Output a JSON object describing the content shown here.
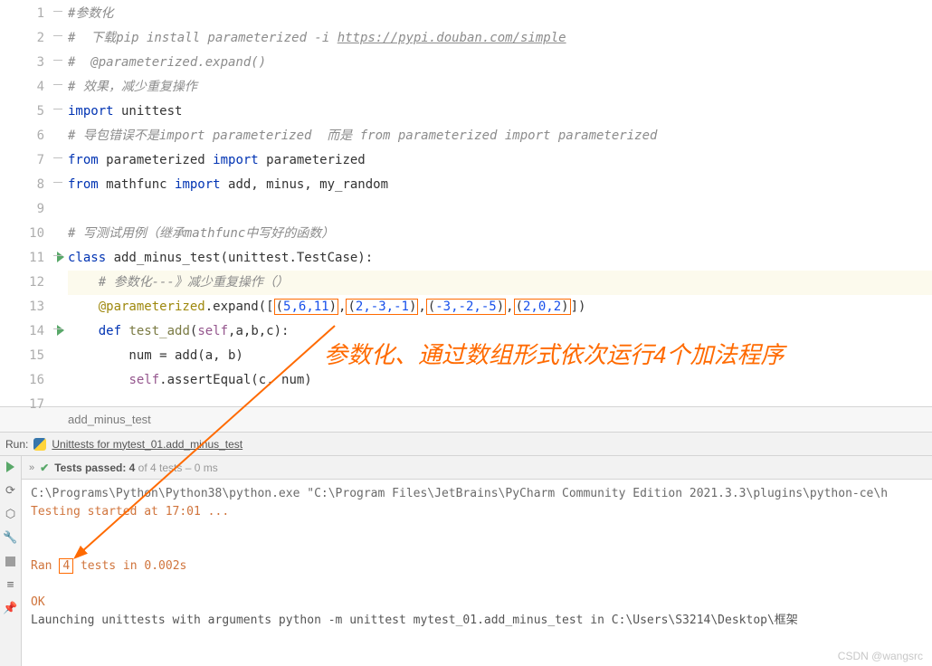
{
  "lines": [
    {
      "n": "1"
    },
    {
      "n": "2"
    },
    {
      "n": "3"
    },
    {
      "n": "4"
    },
    {
      "n": "5"
    },
    {
      "n": "6"
    },
    {
      "n": "7"
    },
    {
      "n": "8"
    },
    {
      "n": "9"
    },
    {
      "n": "10"
    },
    {
      "n": "11",
      "run": true
    },
    {
      "n": "12"
    },
    {
      "n": "13"
    },
    {
      "n": "14",
      "run": true
    },
    {
      "n": "15"
    },
    {
      "n": "16"
    },
    {
      "n": "17"
    }
  ],
  "code": {
    "l1": "#参数化",
    "l2a": "#  下载pip install parameterized -i ",
    "l2b": "https://pypi.douban.com/simple",
    "l3": "#  @parameterized.expand()",
    "l4": "# 效果，减少重复操作",
    "l5_kw1": "import",
    "l5_mod": " unittest",
    "l6": "# 导包错误不是import parameterized  而是 from parameterized import parameterized",
    "l7_k1": "from",
    "l7_m1": " parameterized ",
    "l7_k2": "import",
    "l7_m2": " parameterized",
    "l8_k1": "from",
    "l8_m1": " mathfunc ",
    "l8_k2": "import",
    "l8_m2": " add, minus, my_random",
    "l10": "# 写测试用例（继承mathfunc中写好的函数）",
    "l11_k": "class ",
    "l11_n": "add_minus_test",
    "l11_p": "(unittest.TestCase):",
    "l12": "# 参数化---》减少重复操作（）",
    "l13_dec": "@parameterized",
    "l13_exp": ".expand([",
    "l13_t1": "(",
    "l13_t1v": "5,6,11",
    "l13_t1e": ")",
    "l13_c1": ",",
    "l13_t2": "(",
    "l13_t2v": "2,-3,-1",
    "l13_t2e": ")",
    "l13_c2": ",",
    "l13_t3": "(",
    "l13_t3v": "-3,-2,-5",
    "l13_t3e": ")",
    "l13_c3": ",",
    "l13_t4": "(",
    "l13_t4v": "2,0,2",
    "l13_t4e": ")",
    "l13_end": "])",
    "l14_k": "def ",
    "l14_f": "test_add",
    "l14_p": "(",
    "l14_s": "self",
    "l14_r": ",a,b,c):",
    "l15": "        num = add(a, b)",
    "l16_s": "self",
    "l16_r": ".assertEqual(c, num)"
  },
  "breadcrumb": "add_minus_test",
  "run": {
    "label": "Run:",
    "config": "Unittests for mytest_01.add_minus_test"
  },
  "status": {
    "prefix": "Tests passed: 4",
    "suffix": " of 4 tests – 0 ms"
  },
  "console": {
    "cmd": "C:\\Programs\\Python\\Python38\\python.exe \"C:\\Program Files\\JetBrains\\PyCharm Community Edition 2021.3.3\\plugins\\python-ce\\h",
    "start": "Testing started at 17:01 ...",
    "ran_pre": "Ran ",
    "ran_n": "4",
    "ran_post": " tests in 0.002s",
    "ok": "OK",
    "launch": "Launching unittests with arguments python -m unittest mytest_01.add_minus_test in C:\\Users\\S3214\\Desktop\\框架"
  },
  "annotation": "参数化、通过数组形式依次运行4个加法程序",
  "watermark": "CSDN @wangsrc"
}
